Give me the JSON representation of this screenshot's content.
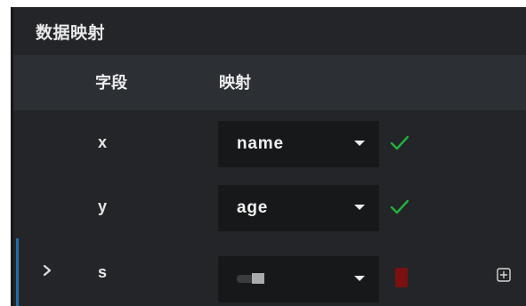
{
  "panel": {
    "title": "数据映射"
  },
  "columns": {
    "field": "字段",
    "mapping": "映射"
  },
  "rows": [
    {
      "field": "x",
      "mapping": "name",
      "status": "valid",
      "status_icon": "check-icon"
    },
    {
      "field": "y",
      "mapping": "age",
      "status": "valid",
      "status_icon": "check-icon"
    },
    {
      "field": "s",
      "mapping": "",
      "status": "error",
      "status_icon": "error-icon",
      "expand_icon": "chevron-right-icon",
      "action_icon": "add-icon"
    }
  ],
  "colors": {
    "panel_bg": "#232528",
    "header_bg": "#2c2f33",
    "select_bg": "#17181a",
    "valid": "#24b13a",
    "error": "#7b1010",
    "accent": "#1f6fa8"
  }
}
